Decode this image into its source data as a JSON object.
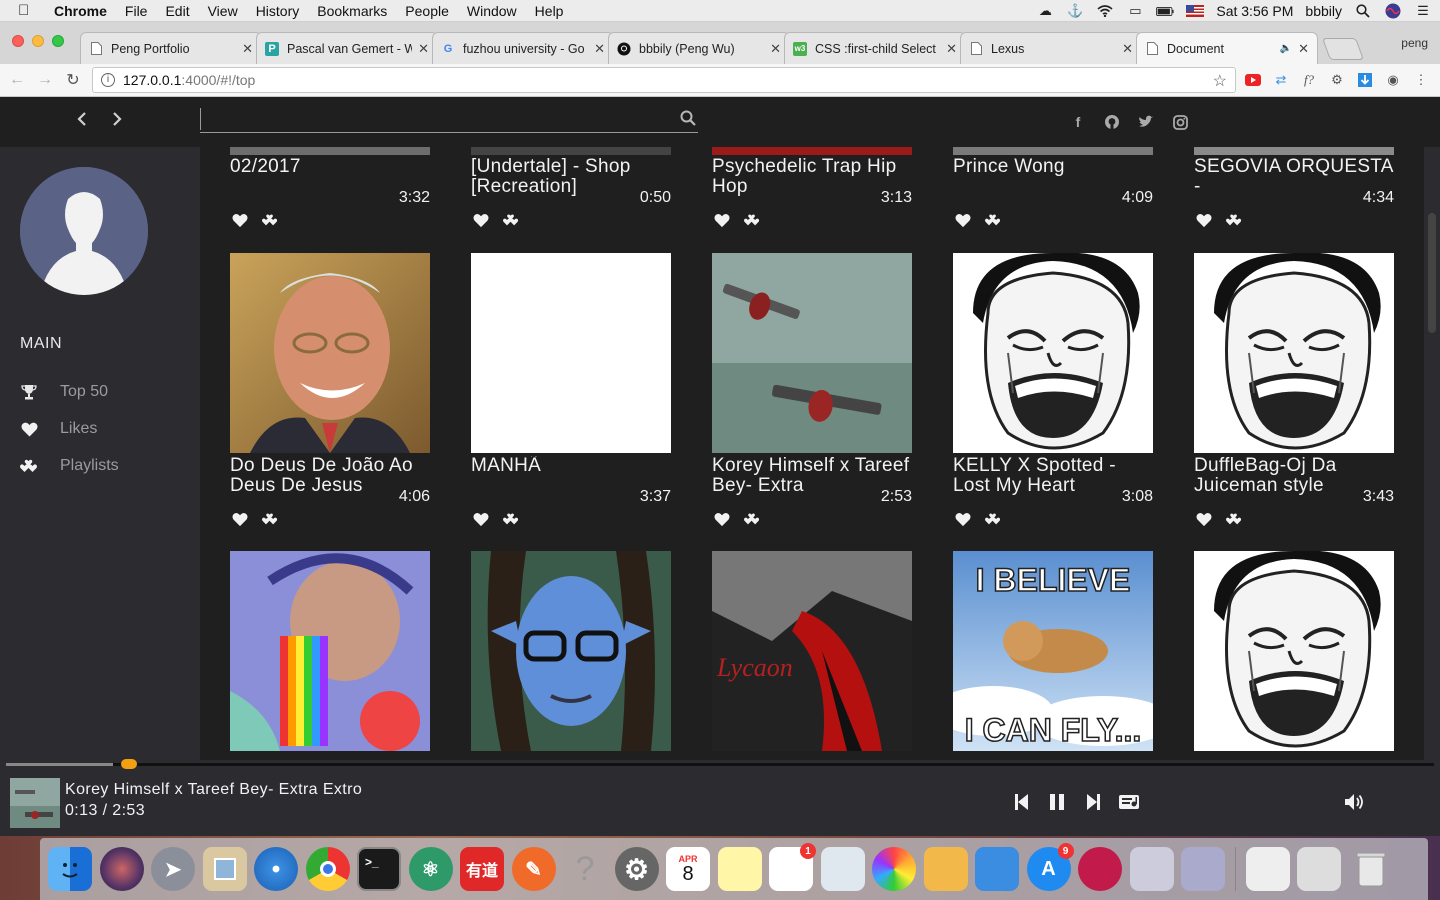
{
  "menubar": {
    "app": "Chrome",
    "items": [
      "File",
      "Edit",
      "View",
      "History",
      "Bookmarks",
      "People",
      "Window",
      "Help"
    ],
    "clock": "Sat 3:56 PM",
    "user": "bbbily"
  },
  "tabs": [
    {
      "title": "Peng Portfolio",
      "favicon": "page-icon",
      "active": false
    },
    {
      "title": "Pascal van Gemert - W",
      "favicon": "P",
      "active": false
    },
    {
      "title": "fuzhou university - Go",
      "favicon": "G",
      "active": false
    },
    {
      "title": "bbbily (Peng Wu)",
      "favicon": "github-icon",
      "active": false
    },
    {
      "title": "CSS :first-child Select",
      "favicon": "w3",
      "active": false
    },
    {
      "title": "Lexus",
      "favicon": "page-icon",
      "active": false
    },
    {
      "title": "Document",
      "favicon": "page-icon",
      "active": true
    }
  ],
  "profile": "peng",
  "omnibox": {
    "host": "127.0.0.1",
    "path": ":4000/#!/top"
  },
  "search": {
    "placeholder": ""
  },
  "sidebar": {
    "heading": "MAIN",
    "items": [
      {
        "label": "Top 50",
        "icon": "trophy-icon"
      },
      {
        "label": "Likes",
        "icon": "heart-icon"
      },
      {
        "label": "Playlists",
        "icon": "playlist-icon"
      }
    ]
  },
  "songs_row0": [
    {
      "title": "02/2017",
      "duration": "3:32"
    },
    {
      "title": "[Undertale] - Shop [Recreation]",
      "duration": "0:50"
    },
    {
      "title": "Psychedelic Trap Hip Hop",
      "duration": "3:13"
    },
    {
      "title": "Prince Wong",
      "duration": "4:09"
    },
    {
      "title": "SEGOVIA ORQUESTA -",
      "duration": "4:34"
    }
  ],
  "songs_row1": [
    {
      "title": "Do Deus De João Ao Deus De Jesus",
      "duration": "4:06"
    },
    {
      "title": "MANHÃ",
      "duration": "3:37"
    },
    {
      "title": "Korey Himself x Tareef Bey- Extra",
      "duration": "2:53"
    },
    {
      "title": "KELLY X Spotted - Lost My Heart",
      "duration": "3:08"
    },
    {
      "title": "DuffleBag-Oj Da Juiceman style",
      "duration": "3:43"
    }
  ],
  "row2_captions": [
    "Lycaon",
    "I BELIEVE",
    "I CAN FLY..."
  ],
  "player": {
    "title": "Korey Himself x Tareef Bey- Extra Extro",
    "time": "0:13 / 2:53",
    "progress": 0.075
  },
  "dock": {
    "youdao": "有道",
    "calendar_month": "APR",
    "calendar_day": "8",
    "badges": {
      "reminders": "1",
      "appstore": "9"
    }
  }
}
